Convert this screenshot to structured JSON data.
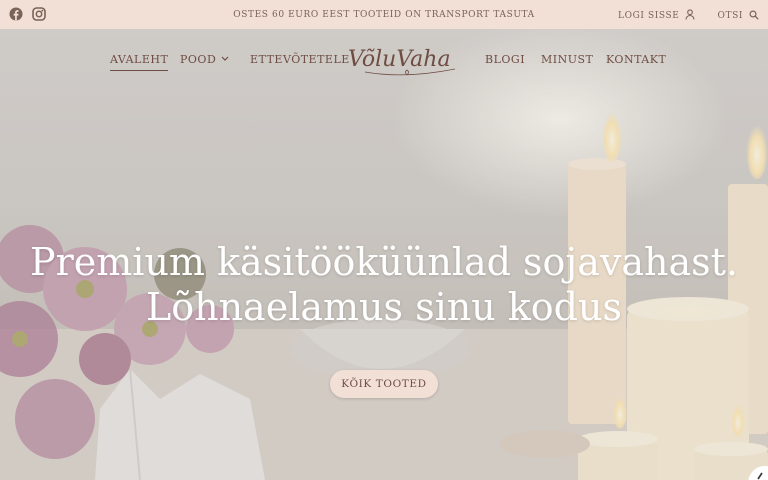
{
  "topbar": {
    "social": [
      {
        "icon": "facebook-icon"
      },
      {
        "icon": "instagram-icon"
      }
    ],
    "promo": "OSTES 60 EURO EEST TOOTEID ON TRANSPORT TASUTA",
    "login_label": "LOGI SISSE",
    "search_label": "OTSI"
  },
  "nav": {
    "items": [
      {
        "label": "AVALEHT",
        "active": true
      },
      {
        "label": "POOD",
        "has_dropdown": true
      },
      {
        "label": "ETTEVÕTETELE"
      },
      {
        "label": "BLOGI"
      },
      {
        "label": "MINUST"
      },
      {
        "label": "KONTAKT"
      }
    ],
    "logo_text": "VõluVaha"
  },
  "hero": {
    "headline_line1": "Premium käsitööküünlad sojavahast.",
    "headline_line2": "Lõhnaelamus sinu kodus",
    "cta_label": "KÕIK TOOTED"
  },
  "colors": {
    "topbar_bg": "#f2dfd6",
    "text_brown": "#6f4d43",
    "button_bg": "#f2dfd6"
  }
}
